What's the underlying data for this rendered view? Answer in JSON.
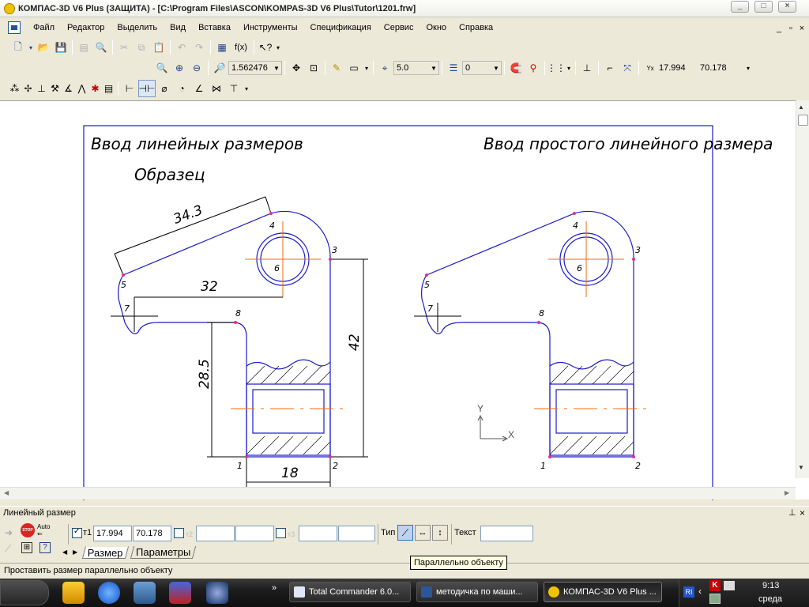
{
  "window": {
    "title": "КОМПАС-3D V6 Plus (ЗАЩИТА) - [C:\\Program Files\\ASCON\\KOMPAS-3D V6 Plus\\Tutor\\1201.frw]",
    "min": "_",
    "max": "□",
    "close": "×"
  },
  "menu": {
    "items": [
      "Файл",
      "Редактор",
      "Выделить",
      "Вид",
      "Вставка",
      "Инструменты",
      "Спецификация",
      "Сервис",
      "Окно",
      "Справка"
    ],
    "doc_min": "_",
    "doc_restore": "▫",
    "doc_close": "×"
  },
  "toolbar": {
    "zoom": "1.562476",
    "step": "5.0",
    "layer": "0",
    "coord_x": "17.994",
    "coord_y": "70.178",
    "fx": "f(x)",
    "coord_label": "Yx"
  },
  "drawing": {
    "title_left": "Ввод линейных размеров",
    "title_right": "Ввод простого линейного размера",
    "sample": "Образец",
    "dims": {
      "d343": "34.3",
      "d32": "32",
      "d285": "28.5",
      "d42": "42",
      "d18": "18"
    },
    "pts_left": [
      "1",
      "2",
      "3",
      "4",
      "5",
      "6",
      "7",
      "8"
    ],
    "pts_right": [
      "1",
      "2",
      "3",
      "4",
      "5",
      "6",
      "7",
      "8"
    ],
    "axis_x": "X",
    "axis_y": "Y"
  },
  "panel": {
    "title": "Линейный размер",
    "pin": "⊥",
    "close": "×",
    "stop_label": "STOP",
    "auto_label": "Auto",
    "t1_label": "т1",
    "t1_x": "17.994",
    "t1_y": "70.178",
    "t2_label": "т2",
    "t3_label": "т3",
    "type_label": "Тип",
    "text_label": "Текст",
    "tabs": [
      "Размер",
      "Параметры"
    ]
  },
  "tooltip": "Параллельно объекту",
  "status": "Проставить размер параллельно объекту",
  "taskbar": {
    "tasks": [
      "Total Commander 6.0...",
      "методичка по маши...",
      "КОМПАС-3D V6 Plus ..."
    ],
    "time": "9:13",
    "day": "среда",
    "lang": "RI",
    "more": "»"
  },
  "colors": {
    "drawing_blue": "#1c1ccc",
    "axis_orange": "#ff6a00",
    "point_magenta": "#e0308a",
    "taskbar": "#1c1c1c"
  }
}
